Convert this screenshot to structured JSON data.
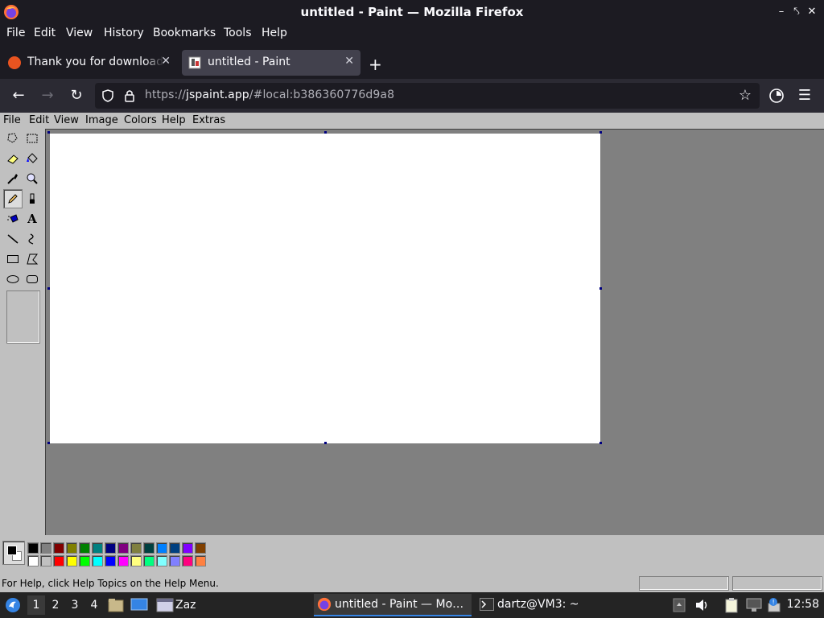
{
  "window": {
    "title": "untitled - Paint — Mozilla Firefox"
  },
  "firefox_menu": [
    "File",
    "Edit",
    "View",
    "History",
    "Bookmarks",
    "Tools",
    "Help"
  ],
  "tabs": [
    {
      "label": "Thank you for downloading",
      "active": false
    },
    {
      "label": "untitled - Paint",
      "active": true
    }
  ],
  "urlbar": {
    "prefix": "https://",
    "host": "jspaint.app",
    "path": "/#local:b386360776d9a8"
  },
  "paint_menu": [
    "File",
    "Edit",
    "View",
    "Image",
    "Colors",
    "Help",
    "Extras"
  ],
  "tools": [
    "free-form-select",
    "select",
    "eraser",
    "fill-with-color",
    "pick-color",
    "magnifier",
    "pencil",
    "brush",
    "airbrush",
    "text",
    "line",
    "curve",
    "rectangle",
    "polygon",
    "ellipse",
    "rounded-rectangle"
  ],
  "selected_tool": "pencil",
  "colors": {
    "foreground": "#000000",
    "background": "#ffffff",
    "palette_top": [
      "#000000",
      "#808080",
      "#800000",
      "#808000",
      "#008000",
      "#008080",
      "#000080",
      "#800080",
      "#808040",
      "#004040",
      "#0080ff",
      "#004080",
      "#8000ff",
      "#804000"
    ],
    "palette_bottom": [
      "#ffffff",
      "#c0c0c0",
      "#ff0000",
      "#ffff00",
      "#00ff00",
      "#00ffff",
      "#0000ff",
      "#ff00ff",
      "#ffff80",
      "#00ff80",
      "#80ffff",
      "#8080ff",
      "#ff0080",
      "#ff8040"
    ]
  },
  "status": {
    "help_text": "For Help, click Help Topics on the Help Menu."
  },
  "taskbar": {
    "workspaces": [
      "1",
      "2",
      "3",
      "4"
    ],
    "active_workspace": "1",
    "folder_label": "Zaz",
    "tasks": [
      {
        "label": "untitled - Paint — Mo…",
        "icon": "firefox-icon"
      },
      {
        "label": "dartz@VM3: ~",
        "icon": "terminal-icon"
      }
    ],
    "clock": "12:58"
  }
}
